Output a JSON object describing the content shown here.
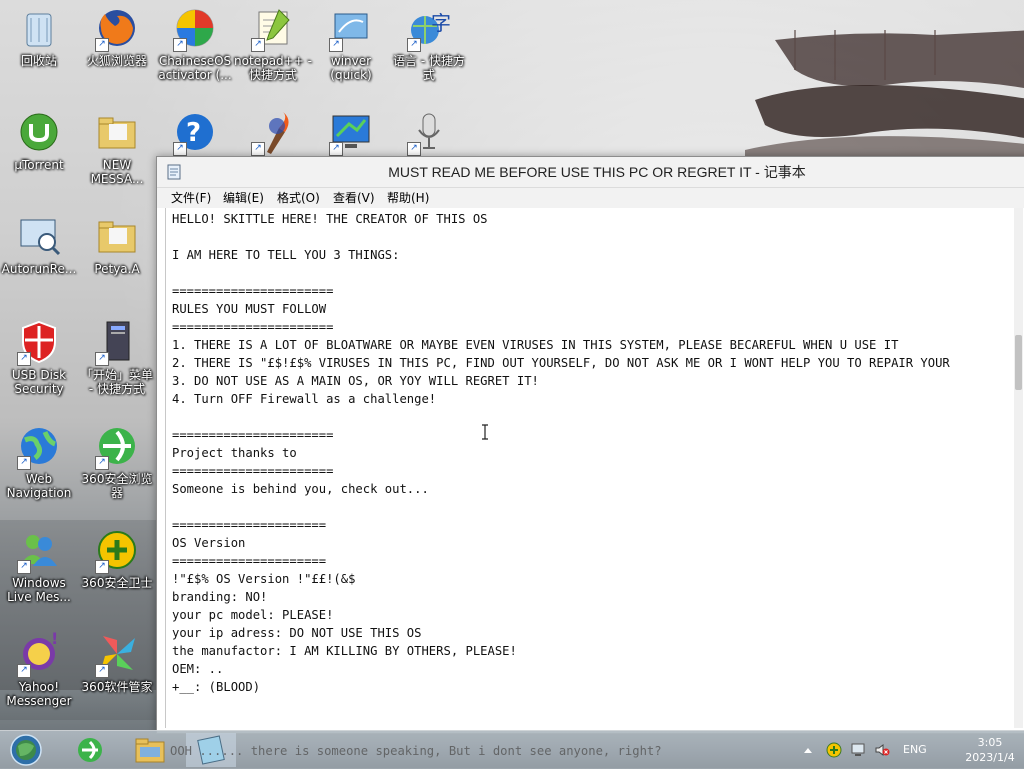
{
  "desktop": {
    "icons": [
      {
        "label": "回收站",
        "icon": "recycle-bin-icon",
        "shortcut": false
      },
      {
        "label": "火狐浏览器",
        "icon": "firefox-icon",
        "shortcut": true
      },
      {
        "label": "ChaineseOS activator (...",
        "icon": "activator-icon",
        "shortcut": true
      },
      {
        "label": "notepad++ - 快捷方式",
        "icon": "notepad-plus-icon",
        "shortcut": true
      },
      {
        "label": "winver (quick)",
        "icon": "winver-icon",
        "shortcut": true
      },
      {
        "label": "语言 - 快捷方式",
        "icon": "language-icon",
        "shortcut": true
      },
      {
        "label": "µTorrent",
        "icon": "utorrent-icon",
        "shortcut": false
      },
      {
        "label": "NEW MESSA...",
        "icon": "folder-icon",
        "shortcut": false
      },
      {
        "label": "",
        "icon": "help-icon",
        "shortcut": true
      },
      {
        "label": "",
        "icon": "torch-icon",
        "shortcut": true
      },
      {
        "label": "",
        "icon": "monitor-icon",
        "shortcut": true
      },
      {
        "label": "",
        "icon": "microphone-icon",
        "shortcut": true
      },
      {
        "label": "AutorunRe...",
        "icon": "autorun-icon",
        "shortcut": false
      },
      {
        "label": "Petya.A",
        "icon": "folder-icon",
        "shortcut": false
      },
      {
        "label": "USB Disk Security",
        "icon": "shield-icon",
        "shortcut": true
      },
      {
        "label": "「开始」菜单 - 快捷方式",
        "icon": "start-menu-icon",
        "shortcut": true
      },
      {
        "label": "Web Navigation",
        "icon": "globe-icon",
        "shortcut": true
      },
      {
        "label": "360安全浏览器",
        "icon": "browser-360-icon",
        "shortcut": true
      },
      {
        "label": "Windows Live Mes...",
        "icon": "messenger-icon",
        "shortcut": true
      },
      {
        "label": "360安全卫士",
        "icon": "guard-360-icon",
        "shortcut": true
      },
      {
        "label": "Yahoo! Messenger",
        "icon": "yahoo-icon",
        "shortcut": true
      },
      {
        "label": "360软件管家",
        "icon": "software-360-icon",
        "shortcut": true
      }
    ]
  },
  "notepad": {
    "title": "MUST READ ME BEFORE USE THIS PC OR REGRET IT - 记事本",
    "menu": [
      "文件(F)",
      "编辑(E)",
      "格式(O)",
      "查看(V)",
      "帮助(H)"
    ],
    "content": "HELLO! SKITTLE HERE! THE CREATOR OF THIS OS\n\nI AM HERE TO TELL YOU 3 THINGS:\n\n======================\nRULES YOU MUST FOLLOW\n======================\n1. THERE IS A LOT OF BLOATWARE OR MAYBE EVEN VIRUSES IN THIS SYSTEM, PLEASE BECAREFUL WHEN U USE IT\n2. THERE IS \"£$!£$% VIRUSES IN THIS PC, FIND OUT YOURSELF, DO NOT ASK ME OR I WONT HELP YOU TO REPAIR YOUR\n3. DO NOT USE AS A MAIN OS, OR YOY WILL REGRET IT!\n4. Turn OFF Firewall as a challenge!\n\n======================\nProject thanks to\n======================\nSomeone is behind you, check out...\n\n=====================\nOS Version\n=====================\n!\"£$% OS Version !\"££!(&$\nbranding: NO!\nyour pc model: PLEASE!\nyour ip adress: DO NOT USE THIS OS\nthe manufactor: I AM KILLING BY OTHERS, PLEASE!\nOEM: ..\n+__: (BLOOD)"
  },
  "taskbar": {
    "ghost_text": "OOH ...... there is someone speaking, But i dont see anyone, right?",
    "language": "ENG",
    "time": "3:05",
    "date": "2023/1/4",
    "pinned": [
      "start-orb-icon",
      "browser-360-icon",
      "explorer-icon",
      "notepad-icon"
    ]
  },
  "colors": {
    "taskbar": "#9aa4ab",
    "title_bar": "#f2f2f2",
    "window_border": "#8c8c8c"
  }
}
